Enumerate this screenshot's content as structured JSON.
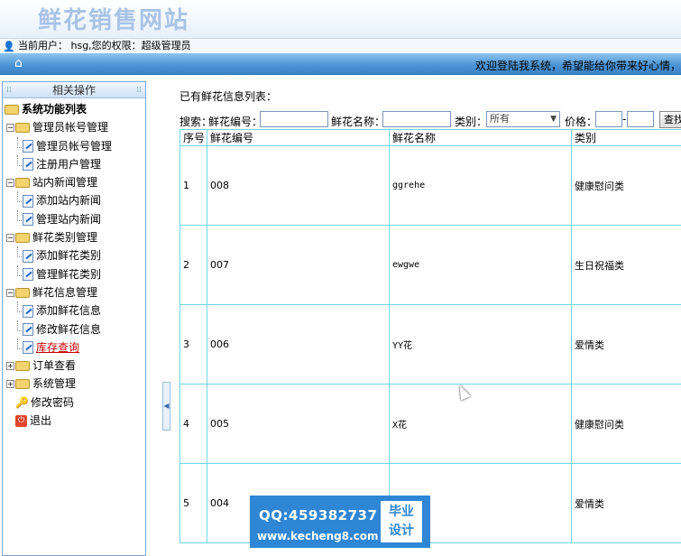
{
  "header": {
    "site_title": "鲜花销售网站"
  },
  "userbar": {
    "user_info": "当前用户： hsg,您的权限：超级管理员"
  },
  "navbar": {
    "welcome": "欢迎登陆我系统，希望能给你带来好心情，"
  },
  "sidebar": {
    "panel_title": "相关操作",
    "root": "系统功能列表",
    "groups": [
      {
        "label": "管理员帐号管理",
        "items": [
          "管理员帐号管理",
          "注册用户管理"
        ]
      },
      {
        "label": "站内新闻管理",
        "items": [
          "添加站内新闻",
          "管理站内新闻"
        ]
      },
      {
        "label": "鲜花类别管理",
        "items": [
          "添加鲜花类别",
          "管理鲜花类别"
        ]
      },
      {
        "label": "鲜花信息管理",
        "items": [
          "添加鲜花信息",
          "修改鲜花信息",
          "库存查询"
        ]
      },
      {
        "label": "订单查看"
      },
      {
        "label": "系统管理"
      }
    ],
    "change_password": "修改密码",
    "logout": "退出"
  },
  "main": {
    "list_title": "已有鲜花信息列表：",
    "search": {
      "label": "搜索：",
      "code_label": "鲜花编号：",
      "name_label": "鲜花名称：",
      "category_label": "类别：",
      "category_value": "所有",
      "price_label": "价格：",
      "button": "查找"
    },
    "table": {
      "headers": [
        "序号",
        "鲜花编号",
        "鲜花名称",
        "类别"
      ],
      "rows": [
        [
          "1",
          "008",
          "ggrehe",
          "健康慰问类"
        ],
        [
          "2",
          "007",
          "ewgwe",
          "生日祝福类"
        ],
        [
          "3",
          "006",
          "YY花",
          "爱情类"
        ],
        [
          "4",
          "005",
          "X花",
          "健康慰问类"
        ],
        [
          "5",
          "004",
          "",
          "爱情类"
        ]
      ]
    }
  },
  "watermark": {
    "qq": "QQ:459382737",
    "url": "www.kecheng8.com",
    "badge_line1": "毕业",
    "badge_line2": "设计"
  }
}
